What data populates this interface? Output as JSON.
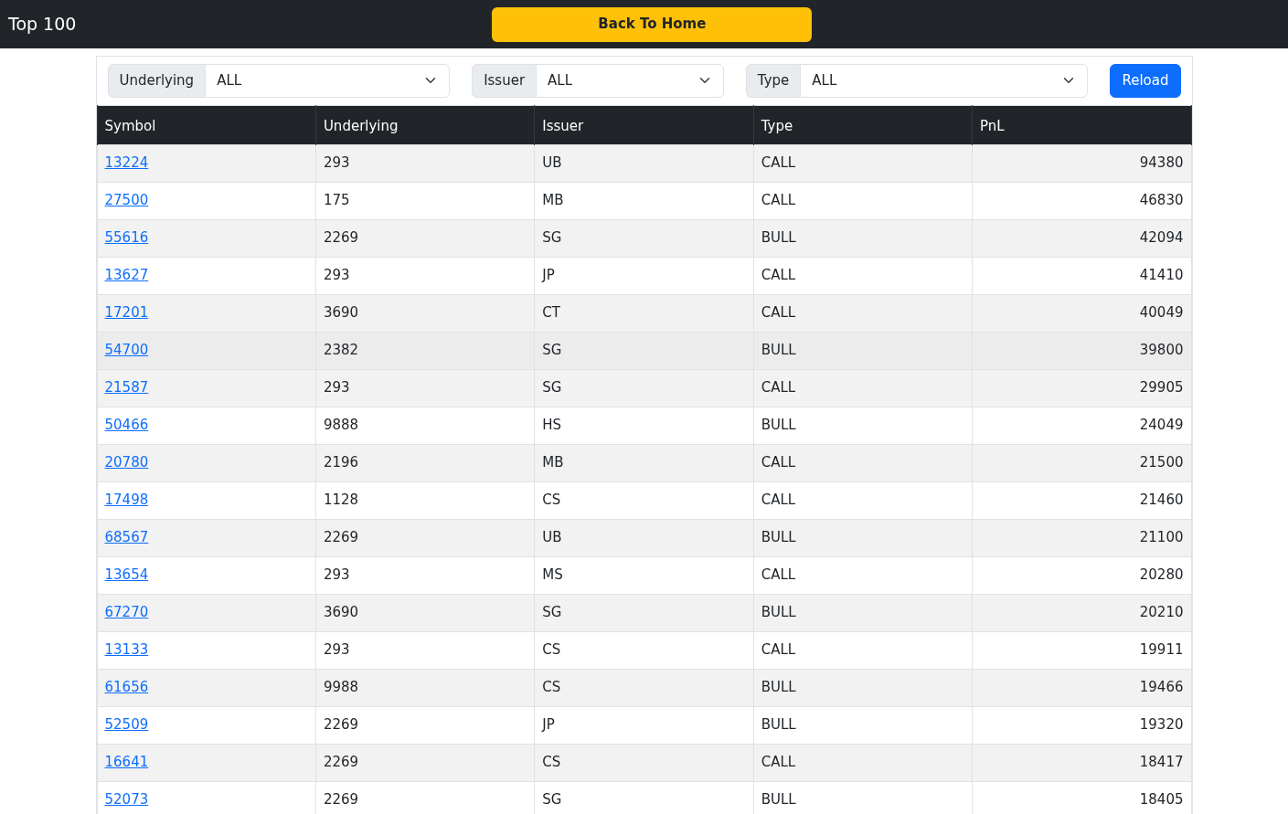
{
  "navbar": {
    "title": "Top 100",
    "home_button": "Back To Home"
  },
  "filters": [
    {
      "label": "Underlying",
      "value": "ALL"
    },
    {
      "label": "Issuer",
      "value": "ALL"
    },
    {
      "label": "Type",
      "value": "ALL"
    }
  ],
  "reload_button": "Reload",
  "table": {
    "columns": [
      "Symbol",
      "Underlying",
      "Issuer",
      "Type",
      "PnL"
    ],
    "rows": [
      {
        "symbol": "13224",
        "underlying": "293",
        "issuer": "UB",
        "type": "CALL",
        "pnl": "94380",
        "hovered": false
      },
      {
        "symbol": "27500",
        "underlying": "175",
        "issuer": "MB",
        "type": "CALL",
        "pnl": "46830",
        "hovered": false
      },
      {
        "symbol": "55616",
        "underlying": "2269",
        "issuer": "SG",
        "type": "BULL",
        "pnl": "42094",
        "hovered": false
      },
      {
        "symbol": "13627",
        "underlying": "293",
        "issuer": "JP",
        "type": "CALL",
        "pnl": "41410",
        "hovered": false
      },
      {
        "symbol": "17201",
        "underlying": "3690",
        "issuer": "CT",
        "type": "CALL",
        "pnl": "40049",
        "hovered": false
      },
      {
        "symbol": "54700",
        "underlying": "2382",
        "issuer": "SG",
        "type": "BULL",
        "pnl": "39800",
        "hovered": true
      },
      {
        "symbol": "21587",
        "underlying": "293",
        "issuer": "SG",
        "type": "CALL",
        "pnl": "29905",
        "hovered": false
      },
      {
        "symbol": "50466",
        "underlying": "9888",
        "issuer": "HS",
        "type": "BULL",
        "pnl": "24049",
        "hovered": false
      },
      {
        "symbol": "20780",
        "underlying": "2196",
        "issuer": "MB",
        "type": "CALL",
        "pnl": "21500",
        "hovered": false
      },
      {
        "symbol": "17498",
        "underlying": "1128",
        "issuer": "CS",
        "type": "CALL",
        "pnl": "21460",
        "hovered": false
      },
      {
        "symbol": "68567",
        "underlying": "2269",
        "issuer": "UB",
        "type": "BULL",
        "pnl": "21100",
        "hovered": false
      },
      {
        "symbol": "13654",
        "underlying": "293",
        "issuer": "MS",
        "type": "CALL",
        "pnl": "20280",
        "hovered": false
      },
      {
        "symbol": "67270",
        "underlying": "3690",
        "issuer": "SG",
        "type": "BULL",
        "pnl": "20210",
        "hovered": false
      },
      {
        "symbol": "13133",
        "underlying": "293",
        "issuer": "CS",
        "type": "CALL",
        "pnl": "19911",
        "hovered": false
      },
      {
        "symbol": "61656",
        "underlying": "9988",
        "issuer": "CS",
        "type": "BULL",
        "pnl": "19466",
        "hovered": false
      },
      {
        "symbol": "52509",
        "underlying": "2269",
        "issuer": "JP",
        "type": "BULL",
        "pnl": "19320",
        "hovered": false
      },
      {
        "symbol": "16641",
        "underlying": "2269",
        "issuer": "CS",
        "type": "CALL",
        "pnl": "18417",
        "hovered": false
      },
      {
        "symbol": "52073",
        "underlying": "2269",
        "issuer": "SG",
        "type": "BULL",
        "pnl": "18405",
        "hovered": false
      }
    ]
  }
}
